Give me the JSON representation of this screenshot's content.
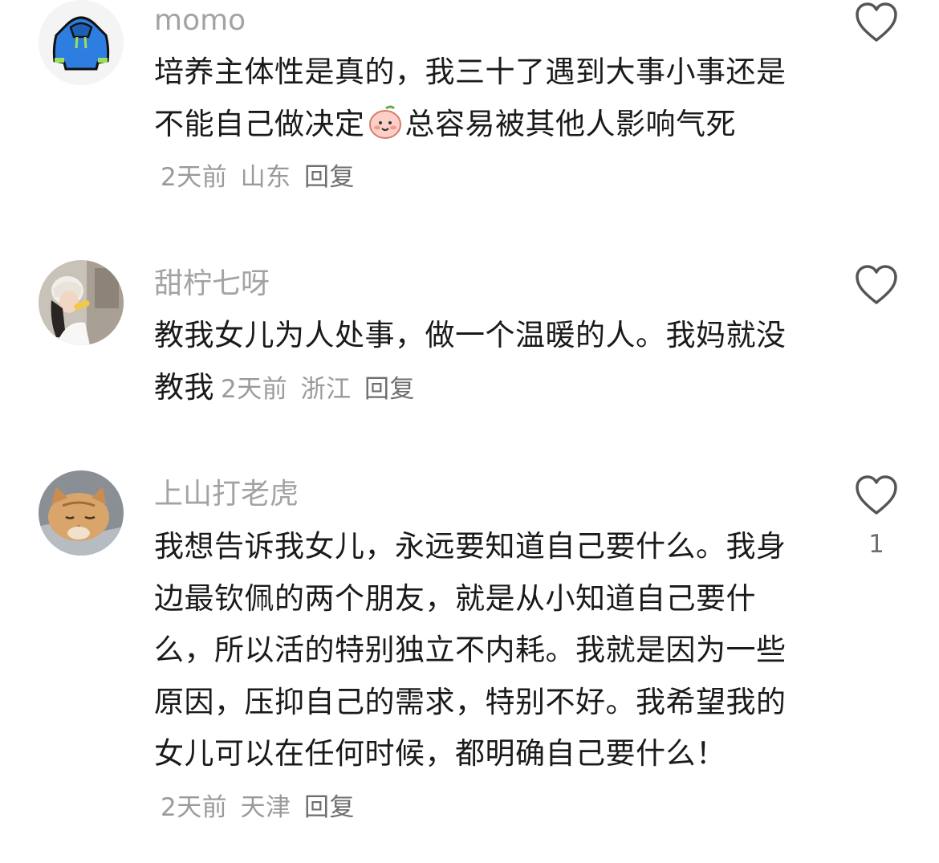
{
  "comments": [
    {
      "username": "momo",
      "avatar_icon": "hoodie-avatar-icon",
      "text_before_emoji": "培养主体性是真的，我三十了遇到大事小事还是不能自己做决定",
      "emoji": "peach-face-emoji",
      "text_after_emoji": "总容易被其他人影响气死",
      "time": "2天前",
      "location": "山东",
      "reply_label": "回复",
      "like_count": ""
    },
    {
      "username": "甜柠七呀",
      "avatar_icon": "photo-avatar-icon",
      "text": "教我女儿为人处事，做一个温暖的人。我妈就没教我",
      "time": "2天前",
      "location": "浙江",
      "reply_label": "回复",
      "like_count": ""
    },
    {
      "username": "上山打老虎",
      "avatar_icon": "cat-avatar-icon",
      "text": "我想告诉我女儿，永远要知道自己要什么。我身边最钦佩的两个朋友，就是从小知道自己要什么，所以活的特别独立不内耗。我就是因为一些原因，压抑自己的需求，特别不好。我希望我的女儿可以在任何时候，都明确自己要什么！",
      "time": "2天前",
      "location": "天津",
      "reply_label": "回复",
      "like_count": "1"
    }
  ],
  "colors": {
    "username": "#a3a3a3",
    "text": "#1a1a1a",
    "meta": "#9a9a9a",
    "icon": "#555555"
  }
}
